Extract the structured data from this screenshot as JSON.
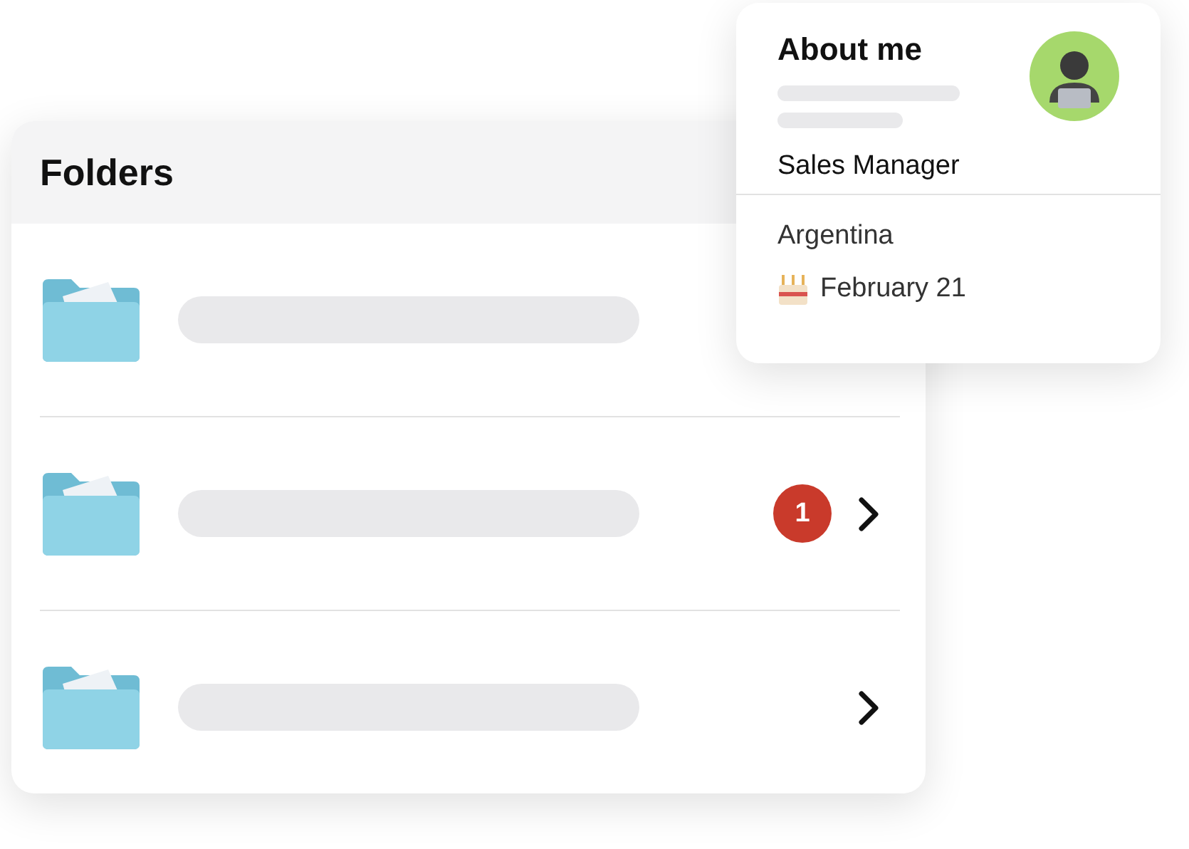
{
  "folders": {
    "title": "Folders",
    "rows": [
      {
        "arrow": false
      },
      {
        "badge": "1",
        "arrow": true
      },
      {
        "arrow": true
      }
    ]
  },
  "about": {
    "title": "About me",
    "role": "Sales Manager",
    "country": "Argentina",
    "birthday": "February 21"
  }
}
